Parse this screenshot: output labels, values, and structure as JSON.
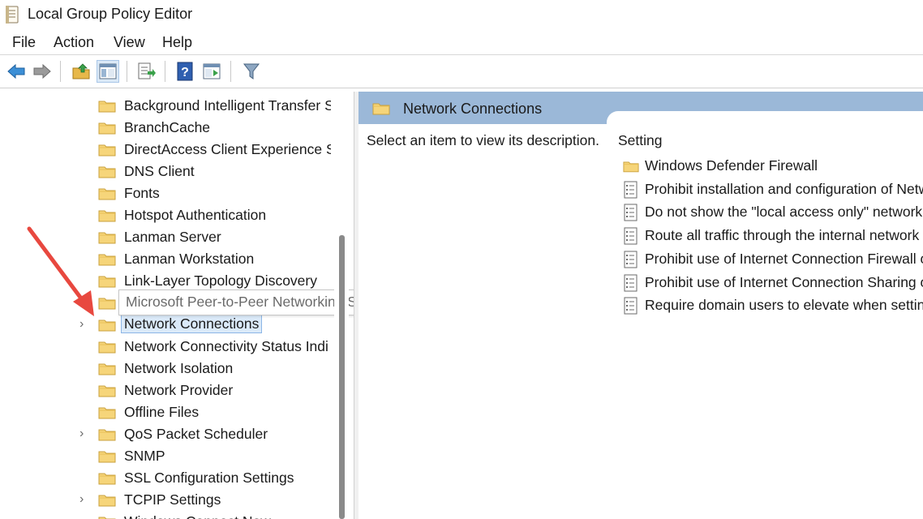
{
  "window": {
    "title": "Local Group Policy Editor"
  },
  "menu": [
    "File",
    "Action",
    "View",
    "Help"
  ],
  "toolbar": {
    "buttons": [
      "back-icon",
      "forward-icon",
      "up-folder-icon",
      "show-hide-tree-icon",
      "export-list-icon",
      "help-icon",
      "properties-pane-icon",
      "filter-icon"
    ]
  },
  "tree": {
    "items": [
      {
        "label": "Background Intelligent Transfer S",
        "expandable": false
      },
      {
        "label": "BranchCache",
        "expandable": false
      },
      {
        "label": "DirectAccess Client Experience Se",
        "expandable": false
      },
      {
        "label": "DNS Client",
        "expandable": false
      },
      {
        "label": "Fonts",
        "expandable": false
      },
      {
        "label": "Hotspot Authentication",
        "expandable": false
      },
      {
        "label": "Lanman Server",
        "expandable": false
      },
      {
        "label": "Lanman Workstation",
        "expandable": false
      },
      {
        "label": "Link-Layer Topology Discovery",
        "expandable": false
      },
      {
        "label": "",
        "expandable": false
      },
      {
        "label": "Network Connections",
        "expandable": true,
        "selected": true
      },
      {
        "label": "Network Connectivity Status Indi",
        "expandable": false
      },
      {
        "label": "Network Isolation",
        "expandable": false
      },
      {
        "label": "Network Provider",
        "expandable": false
      },
      {
        "label": "Offline Files",
        "expandable": false
      },
      {
        "label": "QoS Packet Scheduler",
        "expandable": true
      },
      {
        "label": "SNMP",
        "expandable": false
      },
      {
        "label": "SSL Configuration Settings",
        "expandable": false
      },
      {
        "label": "TCPIP Settings",
        "expandable": true
      },
      {
        "label": "Windows Connect Now",
        "expandable": false
      }
    ],
    "tooltip": "Microsoft Peer-to-Peer Networking Services"
  },
  "details": {
    "header_title": "Network Connections",
    "description": "Select an item to view its description.",
    "column_setting": "Setting",
    "settings": [
      {
        "label": "Windows Defender Firewall",
        "type": "folder"
      },
      {
        "label": "Prohibit installation and configuration of Network Bridge on your DNS domain network",
        "type": "policy"
      },
      {
        "label": "Do not show the \"local access only\" network icon",
        "type": "policy"
      },
      {
        "label": "Route all traffic through the internal network",
        "type": "policy"
      },
      {
        "label": "Prohibit use of Internet Connection Firewall on your DNS domain network",
        "type": "policy"
      },
      {
        "label": "Prohibit use of Internet Connection Sharing on your DNS domain network",
        "type": "policy"
      },
      {
        "label": "Require domain users to elevate when setting a network's location",
        "type": "policy"
      }
    ]
  },
  "colors": {
    "header_blue": "#9bb8d8",
    "selection": "#dbeaf9",
    "folder": "#f2c94c",
    "arrow": "#e8483f"
  }
}
